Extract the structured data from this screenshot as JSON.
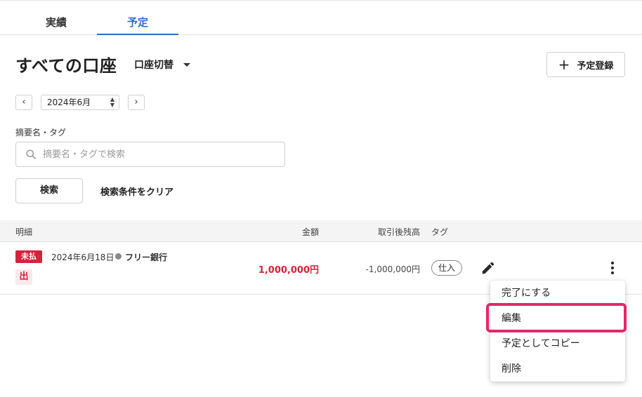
{
  "tabs": [
    {
      "label": "実績"
    },
    {
      "label": "予定"
    }
  ],
  "header": {
    "title": "すべての口座",
    "account_switch_label": "口座切替",
    "add_button_label": "予定登録"
  },
  "period": {
    "prev_label": "‹",
    "next_label": "›",
    "selected_month": "2024年6月"
  },
  "search": {
    "label": "摘要名・タグ",
    "placeholder": "摘要名・タグで検索",
    "value": "",
    "search_button_label": "検索",
    "clear_label": "検索条件をクリア"
  },
  "table": {
    "headers": {
      "detail": "明細",
      "amount": "金額",
      "balance": "取引後残高",
      "tag": "タグ"
    },
    "rows": [
      {
        "status": "未払",
        "date": "2024年6月18日",
        "bank": "フリー銀行",
        "direction": "出",
        "amount": "1,000,000円",
        "balance": "-1,000,000円",
        "tag": "仕入"
      }
    ]
  },
  "context_menu": {
    "items": [
      {
        "label": "完了にする"
      },
      {
        "label": "編集"
      },
      {
        "label": "予定としてコピー"
      },
      {
        "label": "削除"
      }
    ]
  },
  "colors": {
    "accent": "#2b6fd6",
    "danger": "#d6223a",
    "highlight": "#e8266a"
  },
  "icons": {
    "search": "search-icon",
    "edit": "pencil-icon",
    "more": "more-vertical-icon",
    "dropdown": "caret-down-icon",
    "add": "plus-icon"
  }
}
